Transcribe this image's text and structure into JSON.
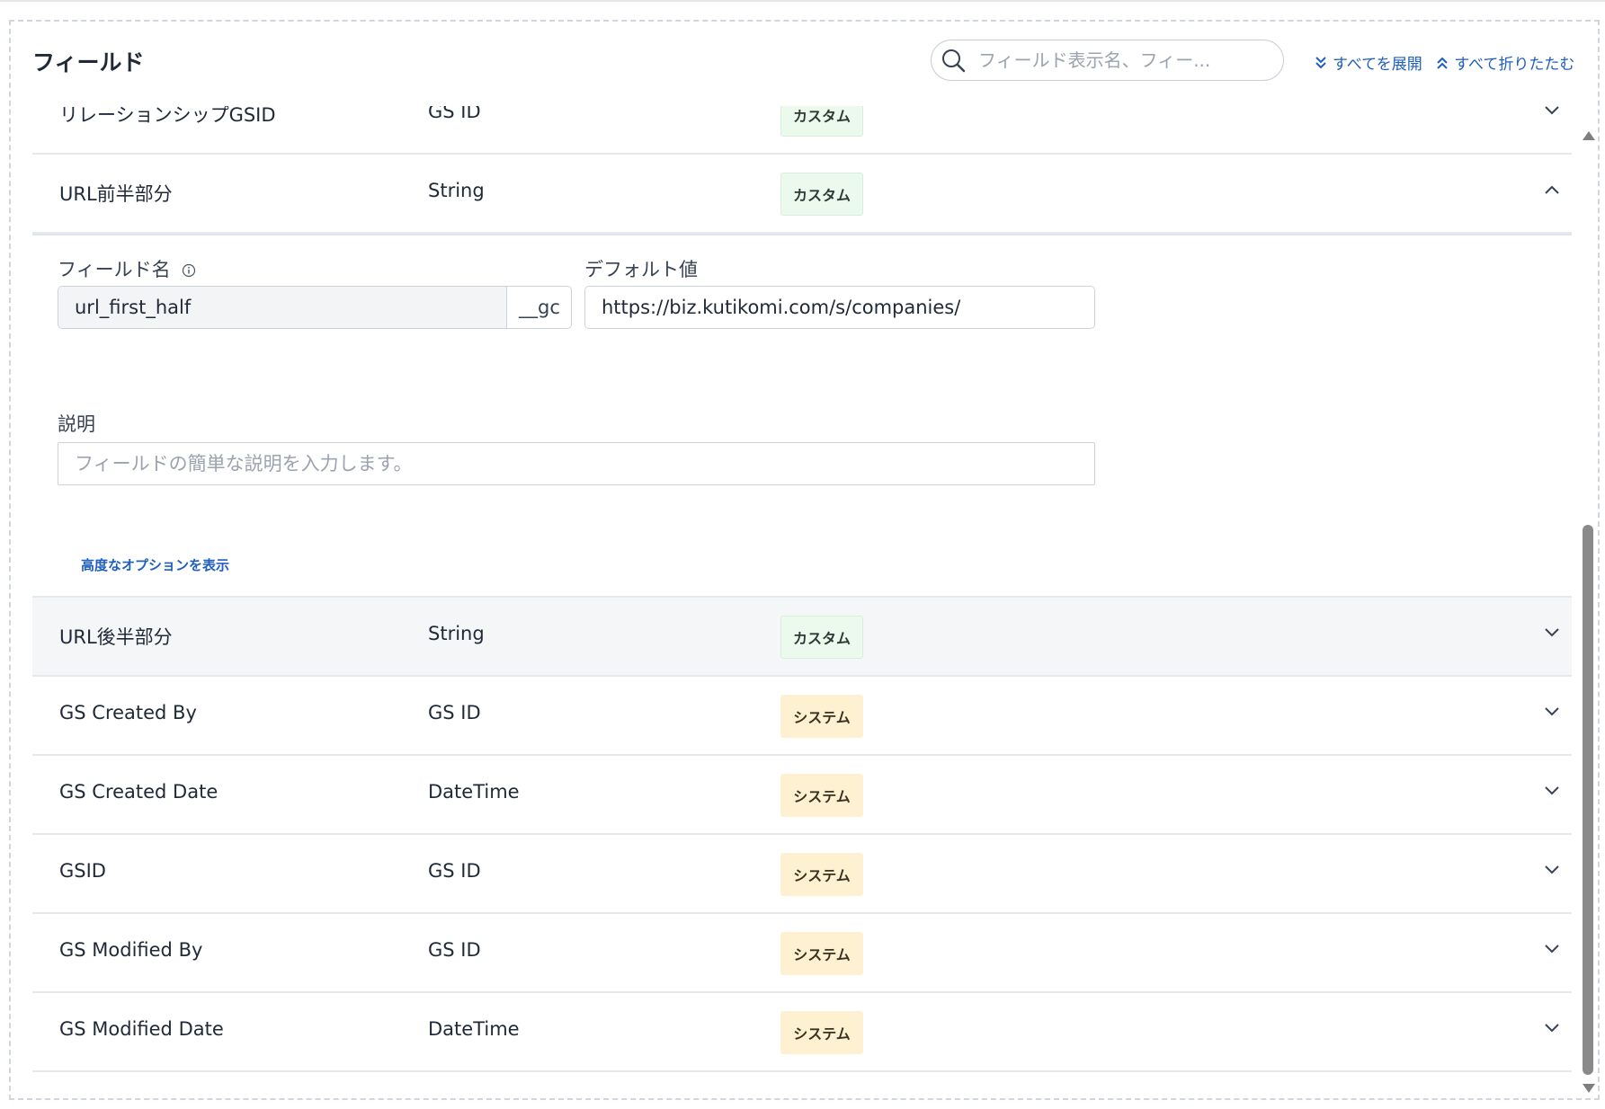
{
  "header": {
    "title": "フィールド",
    "search_placeholder": "フィールド表示名、フィー...",
    "expand_all": "すべてを展開",
    "collapse_all": "すべて折りたたむ"
  },
  "rows": [
    {
      "name": "リレーションシップGSID",
      "type": "GS ID",
      "badge": "カスタム",
      "badge_kind": "custom",
      "state": "collapsed"
    },
    {
      "name": "URL前半部分",
      "type": "String",
      "badge": "カスタム",
      "badge_kind": "custom",
      "state": "expanded"
    },
    {
      "name": "URL後半部分",
      "type": "String",
      "badge": "カスタム",
      "badge_kind": "custom",
      "state": "collapsed"
    },
    {
      "name": "GS Created By",
      "type": "GS ID",
      "badge": "システム",
      "badge_kind": "system",
      "state": "collapsed"
    },
    {
      "name": "GS Created Date",
      "type": "DateTime",
      "badge": "システム",
      "badge_kind": "system",
      "state": "collapsed"
    },
    {
      "name": "GSID",
      "type": "GS ID",
      "badge": "システム",
      "badge_kind": "system",
      "state": "collapsed"
    },
    {
      "name": "GS Modified By",
      "type": "GS ID",
      "badge": "システム",
      "badge_kind": "system",
      "state": "collapsed"
    },
    {
      "name": "GS Modified Date",
      "type": "DateTime",
      "badge": "システム",
      "badge_kind": "system",
      "state": "collapsed"
    }
  ],
  "details": {
    "field_name_label": "フィールド名",
    "field_name_value": "url_first_half",
    "field_name_suffix": "__gc",
    "default_value_label": "デフォルト値",
    "default_value": "https://biz.kutikomi.com/s/companies/",
    "description_label": "説明",
    "description_placeholder": "フィールドの簡単な説明を入力します。",
    "advanced_options": "高度なオプションを表示"
  },
  "colors": {
    "link": "#1f5fbf",
    "custom_badge_bg": "#ecfaee",
    "system_badge_bg": "#fdf1d2"
  }
}
